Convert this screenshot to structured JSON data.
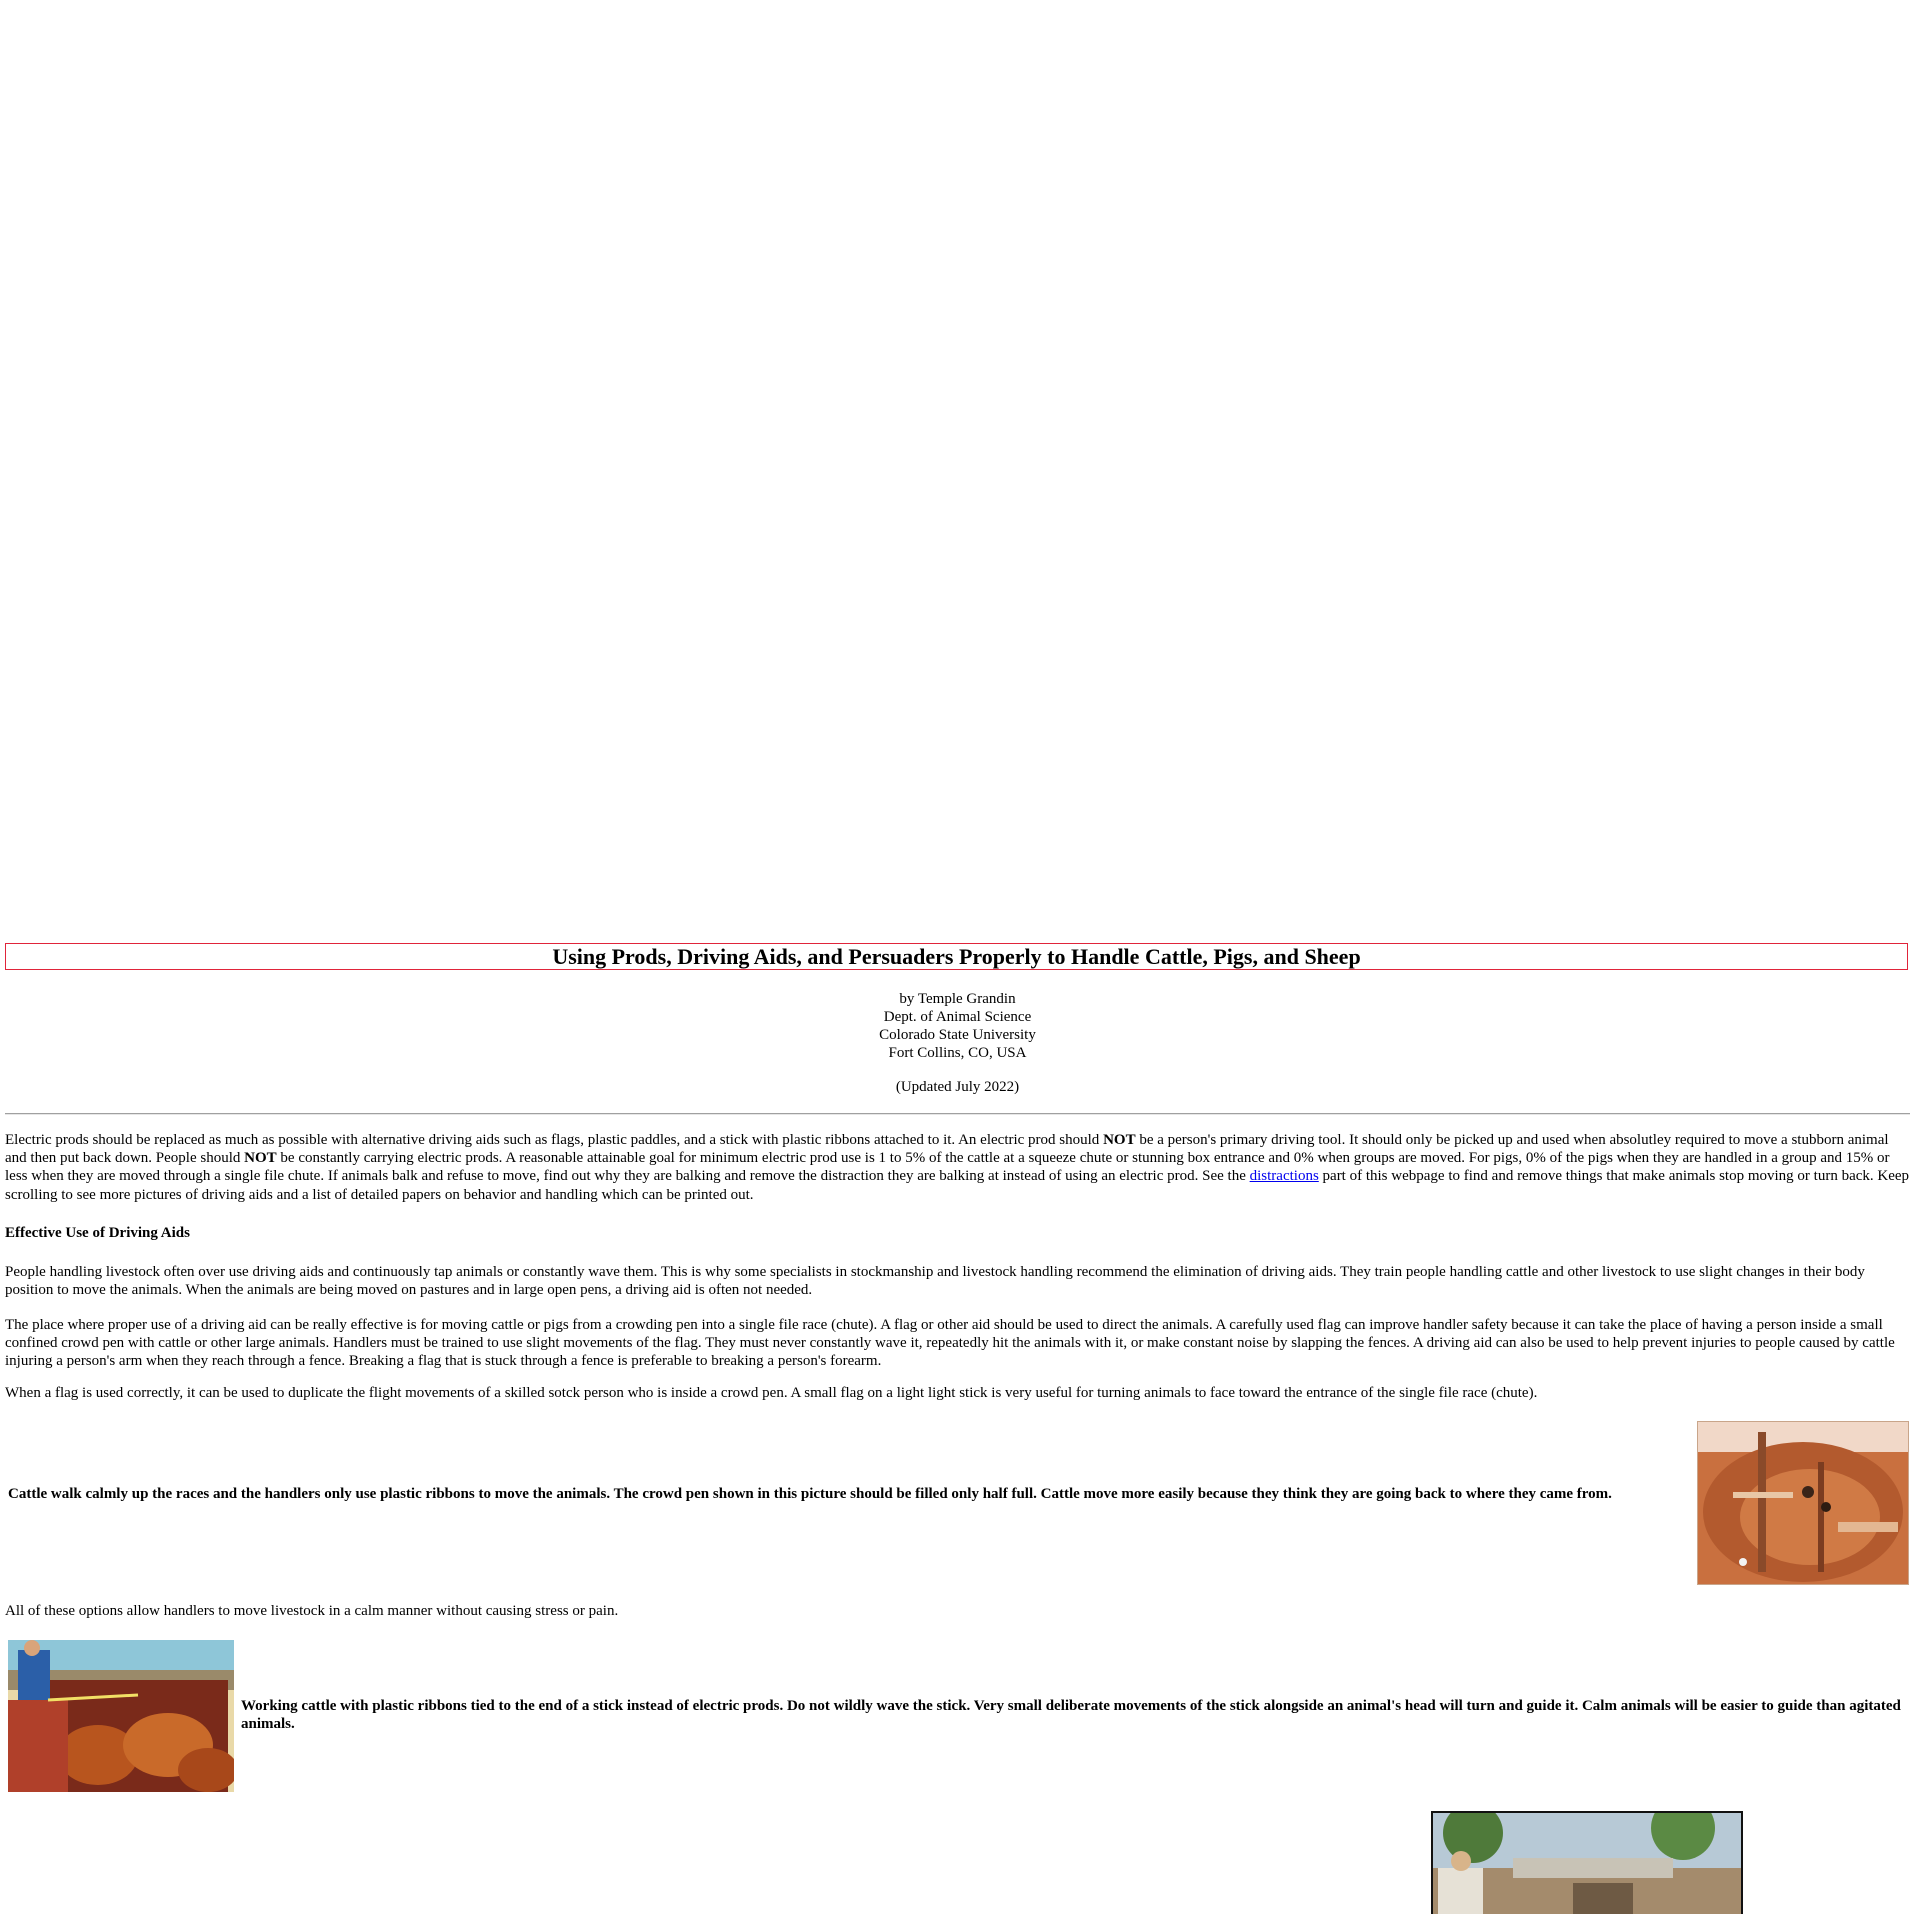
{
  "article": {
    "title": "Using Prods, Driving Aids, and Persuaders Properly to Handle Cattle, Pigs, and Sheep",
    "byline": [
      "by Temple Grandin",
      "Dept. of Animal Science",
      "Colorado State University",
      "Fort Collins, CO, USA"
    ],
    "updated": "(Updated July 2022)",
    "intro": {
      "t1": "Electric prods should be replaced as much as possible with alternative driving aids such as flags, plastic paddles, and a stick with plastic ribbons attached to it. An electric prod should ",
      "b1": "NOT",
      "t2": " be a person's primary driving tool. It should only be picked up and used when absolutley required to move a stubborn animal and then put back down. People should ",
      "b2": "NOT",
      "t3": " be constantly carrying electric prods. A reasonable attainable goal for minimum electric prod use is 1 to 5% of the cattle at a squeeze chute or stunning box entrance and 0% when groups are moved. For pigs, 0% of the pigs when they are handled in a group and 15% or less when they are moved through a single file chute. If animals balk and refuse to move, find out why they are balking and remove the distraction they are balking at instead of using an electric prod. See the ",
      "link": "distractions",
      "t4": " part of this webpage to find and remove things that make animals stop moving or turn back. Keep scrolling to see more pictures of driving aids and a list of detailed papers on behavior and handling which can be printed out."
    },
    "section_heading": "Effective Use of Driving Aids",
    "p2": "People handling livestock often over use driving aids and continuously tap animals or constantly wave them. This is why some specialists in stockmanship and livestock handling recommend the elimination of driving aids. They train people handling cattle and other livestock to use slight changes in their body position to move the animals. When the animals are being moved on pastures and in large open pens, a driving aid is often not needed.",
    "p3": "The place where proper use of a driving aid can be really effective is for moving cattle or pigs from a crowding pen into a single file race (chute). A flag or other aid should be used to direct the animals. A carefully used flag can improve handler safety because it can take the place of having a person inside a small confined crowd pen with cattle or other large animals. Handlers must be trained to use slight movements of the flag. They must never constantly wave it, repeatedly hit the animals with it, or make constant noise by slapping the fences. A driving aid can also be used to help prevent injuries to people caused by cattle injuring a person's arm when they reach through a fence. Breaking a flag that is stuck through a fence is preferable to breaking a person's forearm.",
    "p4": "When a flag is used correctly, it can be used to duplicate the flight movements of a skilled sotck person who is inside a crowd pen. A small flag on a light light stick is very useful for turning animals to face toward the entrance of the single file race (chute).",
    "caption1": "Cattle walk calmly up the races and the handlers only use plastic ribbons to move the animals. The crowd pen shown in this picture should be filled only half full. Cattle move more easily because they think they are going back to where they came from.",
    "p5": "All of these options allow handlers to move livestock in a calm manner without causing stress or pain.",
    "caption2": "Working cattle with plastic ribbons tied to the end of a stick instead of electric prods. Do not wildly wave the stick. Very small deliberate movements of the stick alongside an animal's head will turn and guide it. Calm animals will be easier to guide than agitated animals."
  },
  "colors": {
    "title_border": "#e0243a",
    "link": "#0000ee",
    "rule": "#a0a0a0"
  }
}
